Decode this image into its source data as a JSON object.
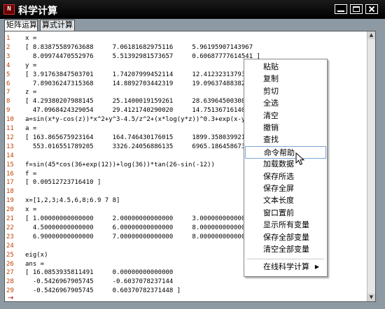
{
  "window": {
    "title": "科学计算",
    "app_icon_text": "N"
  },
  "tabs": [
    {
      "label": "矩阵运算",
      "active": true
    },
    {
      "label": "算式计算",
      "active": false
    }
  ],
  "line_numbers": [
    "1",
    "2",
    "3",
    "4",
    "5",
    "6",
    "7",
    "8",
    "9",
    "10",
    "11",
    "12",
    "13",
    "14",
    "15",
    "16",
    "17",
    "18",
    "19",
    "20",
    "21",
    "22",
    "23",
    "24",
    "25",
    "26",
    "27",
    "28",
    "29"
  ],
  "code_lines": [
    "x =",
    "[ 8.83875589763688     7.06181682975116     5.96195907143967",
    "  8.09974470552976     5.51392981573657     0.60687777614541 ]",
    "y =",
    "[ 3.91763847503701     1.74207999452114     12.4123231379373",
    "  7.89036247315368     14.8892703442319     19.0963748838270 ]",
    "z =",
    "[ 4.29380207988145     25.1400019159261     28.6396450030802",
    "  47.0968424329054     29.4121740290020     14.7513671614003 ]",
    "a=sin(x*y-cos(z))*x^2+y^3-4.5/z^2+(x*log(y*z))^0.3+exp(x-y)",
    "a =",
    "[ 163.865675923164     164.746430176015     1899.35803992125",
    "  553.016551789205     3326.24056886135     6965.18645867320 ]",
    "",
    "f=sin(45*cos(36+exp(12))+log(36))*tan(26-sin(-12))",
    "f =",
    "[ 0.00512723716410 ]",
    "",
    "x=[1,2,3;4.5,6,8;6.9 7 8]",
    "x =",
    "[ 1.00000000000000     2.00000000000000     3.00000000000000",
    "  4.50000000000000     6.00000000000000     8.00000000000000",
    "  6.90000000000000     7.00000000000000     8.00000000000000 ]",
    "",
    "eig(x)",
    "ans =",
    "[ 16.0853935811491     0.00000000000000",
    "  -0.5426967905745     -0.6037078237144",
    "  -0.5426967905745     0.60370782371448 ]"
  ],
  "prompt_arrow": "→",
  "context_menu": [
    {
      "label": "粘贴"
    },
    {
      "label": "复制"
    },
    {
      "label": "剪切"
    },
    {
      "label": "全选"
    },
    {
      "label": "清空"
    },
    {
      "label": "撤销"
    },
    {
      "label": "查找"
    },
    {
      "label": "命令帮助",
      "highlighted": true
    },
    {
      "label": "加载数据"
    },
    {
      "label": "保存所选"
    },
    {
      "label": "保存全屏"
    },
    {
      "label": "文本长度"
    },
    {
      "label": "窗口置前"
    },
    {
      "label": "显示所有变量"
    },
    {
      "label": "保存全部变量"
    },
    {
      "label": "清空全部变量"
    },
    {
      "label": "在线科学计算",
      "has_submenu": true,
      "submenu_arrow": "▶"
    }
  ]
}
